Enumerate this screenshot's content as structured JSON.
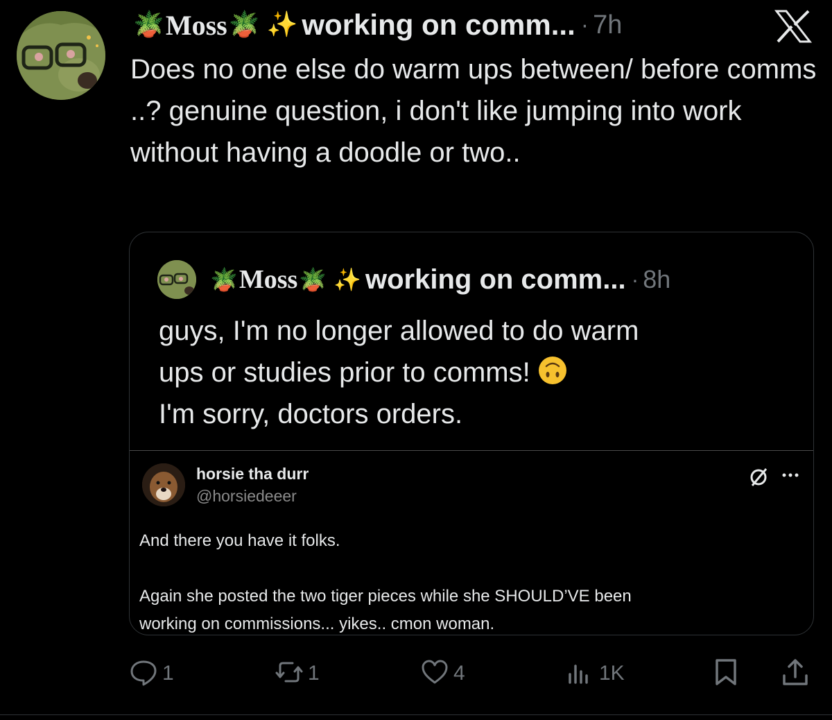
{
  "tweet": {
    "author": {
      "name": "Moss",
      "leading_emoji": "🪴",
      "trailing_emoji": "🪴",
      "sparkle_emoji": "✨",
      "status": "working on comm...",
      "separator": "·",
      "time": "7h"
    },
    "text": "Does no one else do warm ups between/ before comms ..? genuine question, i don't like jumping into work without having a doodle or two.."
  },
  "quote": {
    "author": {
      "name": "Moss",
      "leading_emoji": "🪴",
      "trailing_emoji": "🪴",
      "sparkle_emoji": "✨",
      "status": "working on comm...",
      "separator": "·",
      "time": "8h"
    },
    "line1": "guys, I'm no longer allowed to do warm",
    "line2": "ups or studies prior to comms!",
    "line3": "I'm sorry, doctors orders."
  },
  "embed": {
    "name": "horsie tha durr",
    "handle": "@horsiedeeer",
    "para1": "And there you have it folks.",
    "para2_line1": "Again she posted the two tiger pieces while she SHOULD’VE been",
    "para2_line2": "working on commissions... yikes.. cmon woman."
  },
  "actions": {
    "replies": "1",
    "reposts": "1",
    "likes": "4",
    "views": "1K"
  },
  "icons": {
    "platform": "x-logo-icon",
    "reply": "reply-icon",
    "repost": "repost-icon",
    "like": "heart-icon",
    "views": "views-icon",
    "bookmark": "bookmark-icon",
    "share": "share-icon"
  },
  "colors": {
    "background": "#000000",
    "text": "#e7e9ea",
    "muted": "#71767b",
    "border": "#2f3336"
  }
}
